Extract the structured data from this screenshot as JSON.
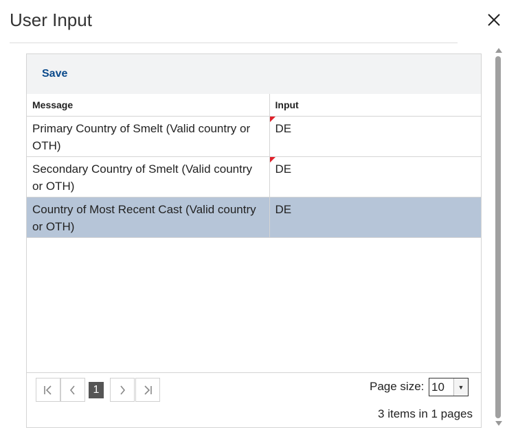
{
  "dialog": {
    "title": "User Input",
    "close_icon": "close-icon"
  },
  "toolbar": {
    "save_label": "Save"
  },
  "grid": {
    "columns": [
      "Message",
      "Input"
    ],
    "rows": [
      {
        "message": "Primary Country of Smelt (Valid country or OTH)",
        "input": "DE",
        "dirty": true
      },
      {
        "message": "Secondary Country of Smelt (Valid country or OTH)",
        "input": "DE",
        "dirty": true
      },
      {
        "message": "Country of Most Recent Cast (Valid country or OTH)",
        "input": "DE",
        "dirty": false,
        "selected": true
      }
    ],
    "dirty_color": "#e0202a",
    "selected_color": "#b6c5d8"
  },
  "pager": {
    "current_page": "1",
    "page_size_label": "Page size:",
    "page_size": "10",
    "info": "3 items in 1 pages",
    "icons": [
      "first-page-icon",
      "prev-page-icon",
      "next-page-icon",
      "last-page-icon"
    ]
  }
}
